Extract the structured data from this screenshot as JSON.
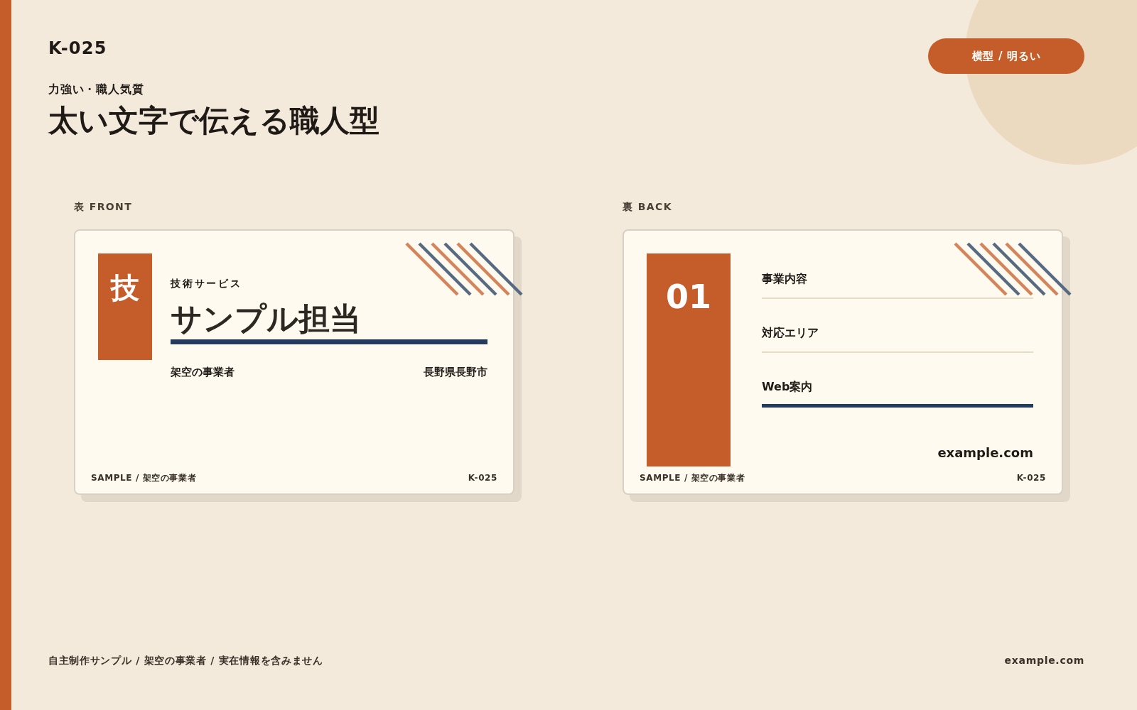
{
  "code": "K-025",
  "badge": "横型 / 明るい",
  "tagline": "力強い・職人気質",
  "title": "太い文字で伝える職人型",
  "front": {
    "side_label": "表 FRONT",
    "mark": "技",
    "category": "技術サービス",
    "name": "サンプル担当",
    "company": "架空の事業者",
    "location": "長野県長野市",
    "footer_left": "SAMPLE / 架空の事業者",
    "footer_right": "K-025"
  },
  "back": {
    "side_label": "裏 BACK",
    "number": "01",
    "items": [
      {
        "label": "事業内容",
        "emphasized": false
      },
      {
        "label": "対応エリア",
        "emphasized": false
      },
      {
        "label": "Web案内",
        "emphasized": true
      }
    ],
    "website": "example.com",
    "footer_left": "SAMPLE / 架空の事業者",
    "footer_right": "K-025"
  },
  "footer": {
    "note": "自主制作サンプル / 架空の事業者 / 実在情報を含みません",
    "site": "example.com"
  }
}
